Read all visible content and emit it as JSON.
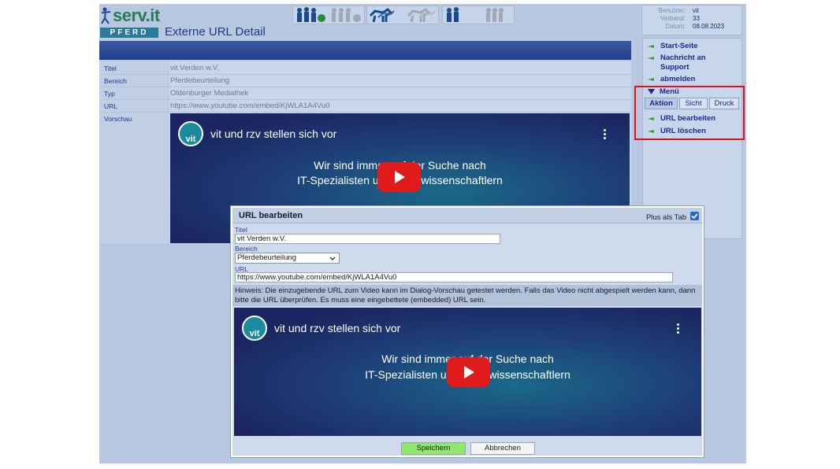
{
  "header": {
    "logo_text": "serv.it",
    "subbrand": "PFERD",
    "page_title": "Externe URL Detail"
  },
  "user_info": {
    "benutzer_label": "Benutzer:",
    "benutzer_value": "vit",
    "verband_label": "Verband:",
    "verband_value": "33",
    "datum_label": "Datum:",
    "datum_value": "08.08.2023"
  },
  "nav": {
    "links": [
      "Start-Seite",
      "Nachricht an Support",
      "abmelden"
    ],
    "menu_label": "Menü",
    "menu_tabs": [
      "Aktion",
      "Sicht",
      "Druck"
    ],
    "active_tab": "Aktion",
    "menu_items": [
      "URL bearbeiten",
      "URL löschen"
    ]
  },
  "detail": {
    "rows": [
      {
        "label": "Titel",
        "value": "vit Verden w.V."
      },
      {
        "label": "Bereich",
        "value": "Pferdebeurteilung"
      },
      {
        "label": "Typ",
        "value": "Oldenburger Mediathek"
      },
      {
        "label": "URL",
        "value": "https://www.youtube.com/embed/KjWLA1A4Vu0"
      },
      {
        "label": "Vorschau",
        "value": ""
      }
    ]
  },
  "video": {
    "channel_logo": "vit",
    "title": "vit und rzv stellen sich vor",
    "line1": "Wir sind immer auf der Suche nach",
    "line2": "IT-Spezialisten und Naturwissenschaftlern"
  },
  "dialog": {
    "title": "URL bearbeiten",
    "plus_als_tab": "Plus als Tab",
    "plus_als_tab_checked": true,
    "titel_label": "Titel",
    "titel_value": "vit Verden w.V.",
    "bereich_label": "Bereich",
    "bereich_value": "Pferdebeurteilung",
    "url_label": "URL",
    "url_value": "https://www.youtube.com/embed/KjWLA1A4Vu0",
    "hint": "Hinweis: Die einzugebende URL zum Video kann im Dialog-Vorschau getestet werden. Falls das Video nicht abgespielt werden kann, dann bitte die URL überprüfen. Es muss eine eingebettete (embedded) URL sein.",
    "save_label": "Speichern",
    "cancel_label": "Abbrechen"
  },
  "colors": {
    "accent_blue": "#1f3d8a",
    "panel_bg": "#c8d6ec",
    "save_green": "#8ee86c",
    "highlight_red": "#e0101a",
    "youtube_red": "#e01b1b"
  }
}
